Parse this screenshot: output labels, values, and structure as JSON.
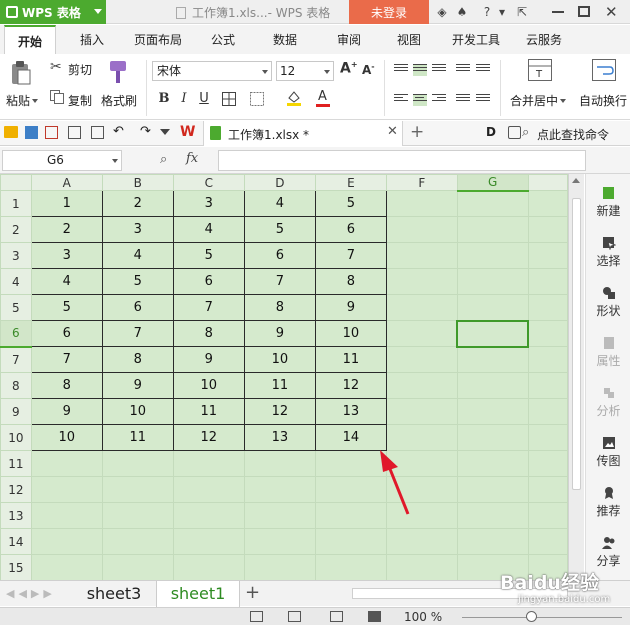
{
  "titlebar": {
    "app_name": "WPS 表格",
    "document_title": "工作簿1.xls...- WPS 表格",
    "login_label": "未登录"
  },
  "menu_tabs": [
    "开始",
    "插入",
    "页面布局",
    "公式",
    "数据",
    "审阅",
    "视图",
    "开发工具",
    "云服务"
  ],
  "ribbon": {
    "cut_label": "剪切",
    "paste_label": "粘贴",
    "copy_label": "复制",
    "format_painter_label": "格式刷",
    "font_name": "宋体",
    "font_size": "12",
    "merge_center_label": "合并居中",
    "wrap_label": "自动换行"
  },
  "doc_tab": {
    "file_name": "工作簿1.xlsx *",
    "find_command": "点此查找命令"
  },
  "formula_bar": {
    "cell_ref": "G6",
    "fx": "fx",
    "content": ""
  },
  "grid": {
    "columns": [
      "A",
      "B",
      "C",
      "D",
      "E",
      "F",
      "G"
    ],
    "row_numbers": [
      "1",
      "2",
      "3",
      "4",
      "5",
      "6",
      "7",
      "8",
      "9",
      "10",
      "11",
      "12",
      "13",
      "14",
      "15"
    ],
    "active_cell": "G6",
    "rows": [
      [
        "1",
        "2",
        "3",
        "4",
        "5"
      ],
      [
        "2",
        "3",
        "4",
        "5",
        "6"
      ],
      [
        "3",
        "4",
        "5",
        "6",
        "7"
      ],
      [
        "4",
        "5",
        "6",
        "7",
        "8"
      ],
      [
        "5",
        "6",
        "7",
        "8",
        "9"
      ],
      [
        "6",
        "7",
        "8",
        "9",
        "10"
      ],
      [
        "7",
        "8",
        "9",
        "10",
        "11"
      ],
      [
        "8",
        "9",
        "10",
        "11",
        "12"
      ],
      [
        "9",
        "10",
        "11",
        "12",
        "13"
      ],
      [
        "10",
        "11",
        "12",
        "13",
        "14"
      ]
    ]
  },
  "sidebar": {
    "items": [
      {
        "label": "新建",
        "icon": "new-icon",
        "enabled": true
      },
      {
        "label": "选择",
        "icon": "select-icon",
        "enabled": true
      },
      {
        "label": "形状",
        "icon": "shape-icon",
        "enabled": true
      },
      {
        "label": "属性",
        "icon": "properties-icon",
        "enabled": false
      },
      {
        "label": "分析",
        "icon": "analyze-icon",
        "enabled": false
      },
      {
        "label": "传图",
        "icon": "upload-image-icon",
        "enabled": true
      },
      {
        "label": "推荐",
        "icon": "recommend-icon",
        "enabled": true
      },
      {
        "label": "分享",
        "icon": "share-icon",
        "enabled": true
      }
    ]
  },
  "sheets": {
    "tabs": [
      "sheet3",
      "sheet1"
    ],
    "active": "sheet1"
  },
  "statusbar": {
    "zoom": "100 %"
  },
  "watermark": {
    "text": "Baidu经验",
    "sub": "jingyan.baidu.com"
  },
  "colors": {
    "accent_green": "#4caa2f",
    "login_orange": "#ea6b4a",
    "grid_background": "#d5eacd",
    "annotation_arrow": "#e0182a"
  }
}
